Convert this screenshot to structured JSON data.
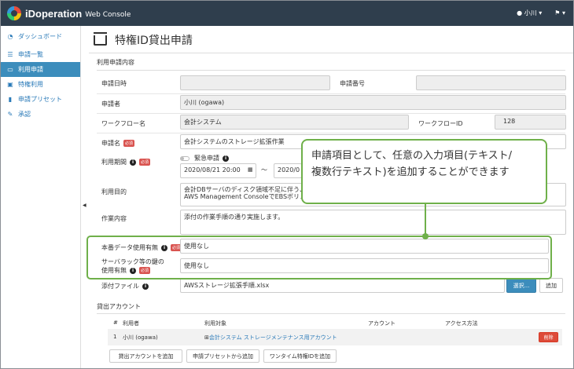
{
  "app": {
    "logo_text": "iDoperation",
    "logo_sub": "Web Console"
  },
  "topbar": {
    "user": "小川",
    "user_icon": "user-icon",
    "bell_icon": "bell-icon"
  },
  "sidebar": {
    "items": [
      {
        "label": "ダッシュボード",
        "icon": "dashboard-icon"
      },
      {
        "label": "申請一覧",
        "icon": "list-icon"
      },
      {
        "label": "利用申請",
        "icon": "inbox-icon"
      },
      {
        "label": "特権利用",
        "icon": "monitor-icon"
      },
      {
        "label": "申請プリセット",
        "icon": "bookmark-icon"
      },
      {
        "label": "承認",
        "icon": "edit-icon"
      }
    ]
  },
  "page": {
    "title": "特権ID貸出申請",
    "section_usage": "利用申請内容",
    "section_accounts": "貸出アカウント"
  },
  "form": {
    "request_date_label": "申請日時",
    "request_date_value": "",
    "request_no_label": "申請番号",
    "request_no_value": "",
    "applicant_label": "申請者",
    "applicant_value": "小川 (ogawa)",
    "workflow_name_label": "ワークフロー名",
    "workflow_name_value": "会計システム",
    "workflow_id_label": "ワークフローID",
    "workflow_id_value": "128",
    "request_name_label": "申請名",
    "request_name_value": "会計システムのストレージ拡張作業",
    "required_badge": "必須",
    "period_label": "利用期間",
    "urgent_label": "緊急申請",
    "period_start": "2020/08/21 20:00",
    "period_sep": "～",
    "period_end": "2020/0",
    "purpose_label": "利用目的",
    "purpose_value_1": "会計DBサーバのディスク領域不足に伴う、",
    "purpose_value_2": "AWS Management ConsoleでEBSボリュー",
    "work_label": "作業内容",
    "work_value": "添付の作業手順の通り実施します。",
    "prod_data_label": "本番データ使用有無",
    "prod_data_value": "使用なし",
    "server_rack_label_1": "サーバラック等の鍵の",
    "server_rack_label_2": "使用有無",
    "server_rack_value": "使用なし",
    "attach_label": "添付ファイル",
    "attach_value": "AWSストレージ拡張手順.xlsx",
    "select_button": "選択...",
    "add_button": "追加"
  },
  "accounts_table": {
    "headers": [
      "#",
      "利用者",
      "利用対象",
      "アカウント",
      "アクセス方法"
    ],
    "rows": [
      {
        "no": "1",
        "user": "小川 (ogawa)",
        "target": "会計システム ストレージメンテナンス用アカウント",
        "account": "",
        "access": "",
        "delete": "削除"
      }
    ]
  },
  "buttons": {
    "add_account": "貸出アカウントを追加",
    "add_preset": "申請プリセットから追加",
    "onetime": "ワンタイム特権IDを追加"
  },
  "callout": {
    "line1": "申請項目として、任意の入力項目(テキスト/",
    "line2": "複数行テキスト)を追加することができます"
  },
  "colors": {
    "topbar": "#2f3e4d",
    "accent": "#3c8dbc",
    "callout": "#6fb04a",
    "required": "#d9534f"
  }
}
